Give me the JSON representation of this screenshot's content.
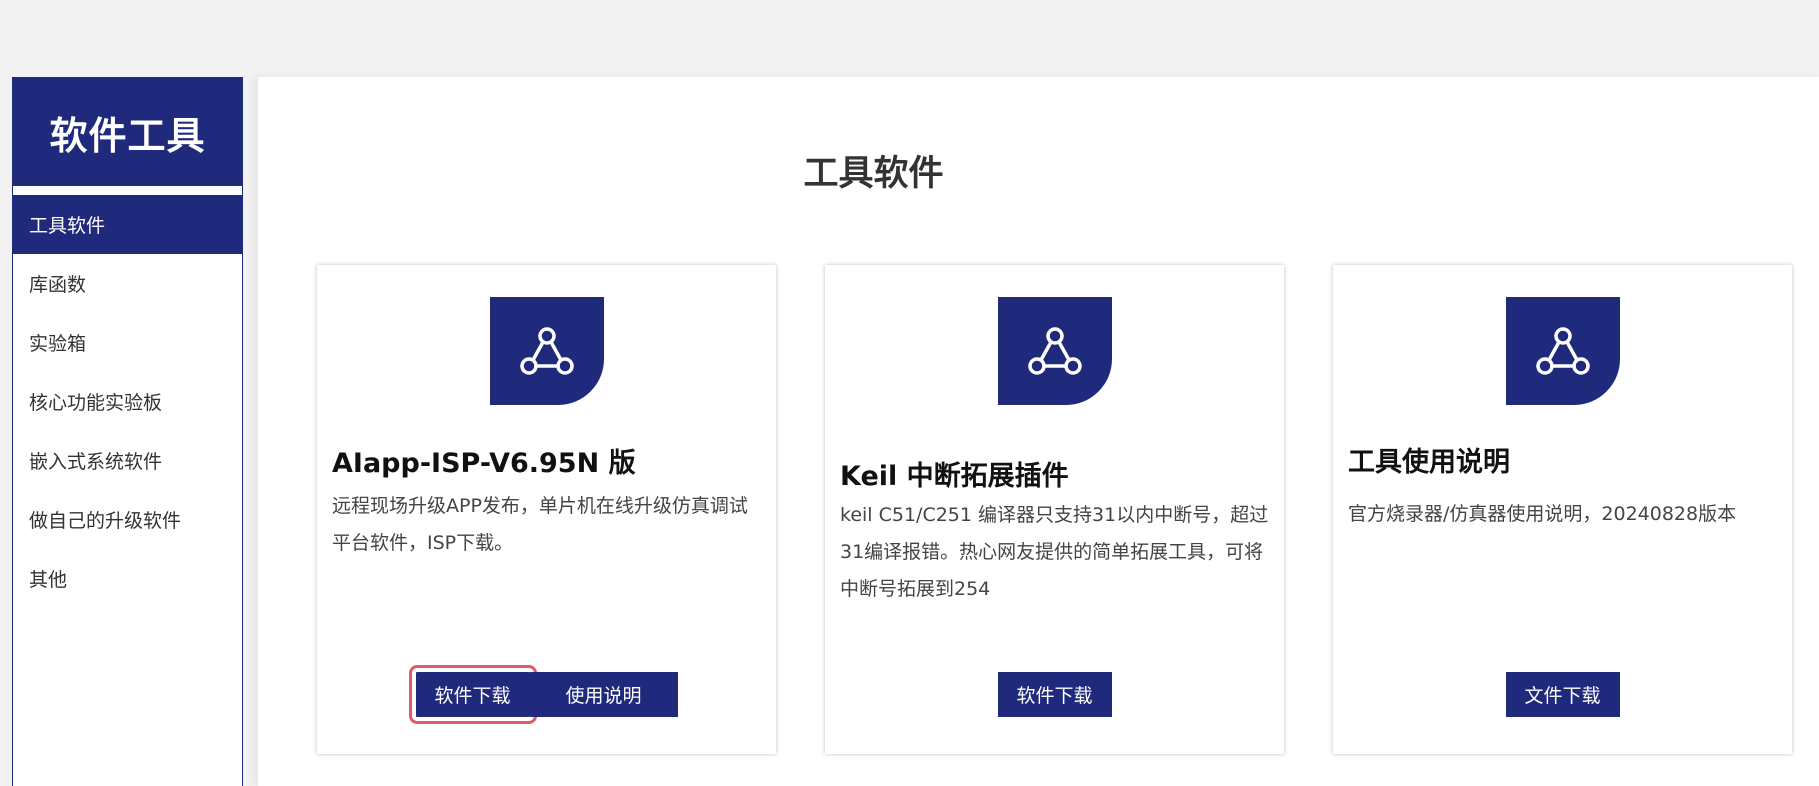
{
  "sidebar": {
    "title": "软件工具",
    "items": [
      {
        "label": "工具软件",
        "active": true
      },
      {
        "label": "库函数"
      },
      {
        "label": "实验箱"
      },
      {
        "label": "核心功能实验板"
      },
      {
        "label": "嵌入式系统软件"
      },
      {
        "label": "做自己的升级软件"
      },
      {
        "label": "其他"
      }
    ]
  },
  "main": {
    "title": "工具软件",
    "cards": [
      {
        "icon": "network-icon",
        "title": "AIapp-ISP-V6.95N 版",
        "desc": "远程现场升级APP发布，单片机在线升级仿真调试平台软件，ISP下载。",
        "buttons": [
          "软件下载",
          "使用说明"
        ]
      },
      {
        "icon": "network-icon",
        "title": "Keil 中断拓展插件",
        "desc": "keil C51/C251 编译器只支持31以内中断号，超过31编译报错。热心网友提供的简单拓展工具，可将中断号拓展到254",
        "buttons": [
          "软件下载"
        ]
      },
      {
        "icon": "network-icon",
        "title": "工具使用说明",
        "desc": "官方烧录器/仿真器使用说明，20240828版本",
        "buttons": [
          "文件下载"
        ]
      }
    ]
  },
  "colors": {
    "brand": "#1f2a7c",
    "highlight": "#e05a6a",
    "background": "#f2f2f2"
  }
}
